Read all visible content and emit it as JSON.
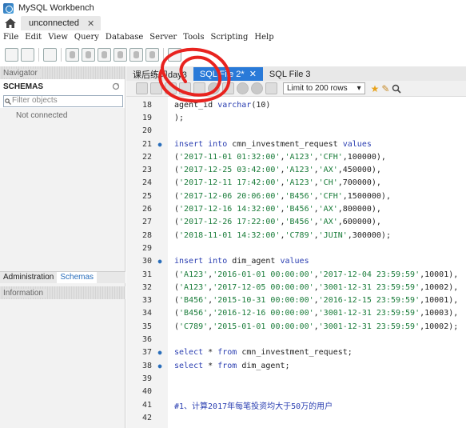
{
  "window": {
    "title": "MySQL Workbench"
  },
  "connection_tab": {
    "label": "unconnected"
  },
  "menu": [
    "File",
    "Edit",
    "View",
    "Query",
    "Database",
    "Server",
    "Tools",
    "Scripting",
    "Help"
  ],
  "navigator": {
    "header": "Navigator",
    "schemas_title": "SCHEMAS",
    "filter_placeholder": "Filter objects",
    "status": "Not connected",
    "tabs": [
      "Administration",
      "Schemas"
    ],
    "info_header": "Information"
  },
  "doc_tabs": [
    {
      "label": "课后练习day3",
      "active": false
    },
    {
      "label": "SQL File 2*",
      "active": true
    },
    {
      "label": "SQL File 3",
      "active": false
    }
  ],
  "editor_toolbar": {
    "limit": "Limit to 200 rows"
  },
  "code_lines": [
    {
      "n": "18",
      "m": "",
      "t": [
        [
          "",
          "agent_id "
        ],
        [
          "kw",
          "varchar"
        ],
        [
          "",
          "(10)"
        ]
      ]
    },
    {
      "n": "19",
      "m": "",
      "t": [
        [
          "",
          ");"
        ]
      ]
    },
    {
      "n": "20",
      "m": "",
      "t": []
    },
    {
      "n": "21",
      "m": "●",
      "t": [
        [
          "kw",
          "insert into "
        ],
        [
          "",
          "cmn_investment_request "
        ],
        [
          "kw",
          "values"
        ]
      ]
    },
    {
      "n": "22",
      "m": "",
      "t": [
        [
          "",
          "("
        ],
        [
          "str",
          "'2017-11-01 01:32:00'"
        ],
        [
          "",
          ","
        ],
        [
          "str",
          "'A123'"
        ],
        [
          "",
          ","
        ],
        [
          "str",
          "'CFH'"
        ],
        [
          "",
          ",100000),"
        ]
      ]
    },
    {
      "n": "23",
      "m": "",
      "t": [
        [
          "",
          "("
        ],
        [
          "str",
          "'2017-12-25 03:42:00'"
        ],
        [
          "",
          ","
        ],
        [
          "str",
          "'A123'"
        ],
        [
          "",
          ","
        ],
        [
          "str",
          "'AX'"
        ],
        [
          "",
          ",450000),"
        ]
      ]
    },
    {
      "n": "24",
      "m": "",
      "t": [
        [
          "",
          "("
        ],
        [
          "str",
          "'2017-12-11 17:42:00'"
        ],
        [
          "",
          ","
        ],
        [
          "str",
          "'A123'"
        ],
        [
          "",
          ","
        ],
        [
          "str",
          "'CH'"
        ],
        [
          "",
          ",700000),"
        ]
      ]
    },
    {
      "n": "25",
      "m": "",
      "t": [
        [
          "",
          "("
        ],
        [
          "str",
          "'2017-12-06 20:06:00'"
        ],
        [
          "",
          ","
        ],
        [
          "str",
          "'B456'"
        ],
        [
          "",
          ","
        ],
        [
          "str",
          "'CFH'"
        ],
        [
          "",
          ",1500000),"
        ]
      ]
    },
    {
      "n": "26",
      "m": "",
      "t": [
        [
          "",
          "("
        ],
        [
          "str",
          "'2017-12-16 14:32:00'"
        ],
        [
          "",
          ","
        ],
        [
          "str",
          "'B456'"
        ],
        [
          "",
          ","
        ],
        [
          "str",
          "'AX'"
        ],
        [
          "",
          ",800000),"
        ]
      ]
    },
    {
      "n": "27",
      "m": "",
      "t": [
        [
          "",
          "("
        ],
        [
          "str",
          "'2017-12-26 17:22:00'"
        ],
        [
          "",
          ","
        ],
        [
          "str",
          "'B456'"
        ],
        [
          "",
          ","
        ],
        [
          "str",
          "'AX'"
        ],
        [
          "",
          ",600000),"
        ]
      ]
    },
    {
      "n": "28",
      "m": "",
      "t": [
        [
          "",
          "("
        ],
        [
          "str",
          "'2018-11-01 14:32:00'"
        ],
        [
          "",
          ","
        ],
        [
          "str",
          "'C789'"
        ],
        [
          "",
          ","
        ],
        [
          "str",
          "'JUIN'"
        ],
        [
          "",
          ",300000);"
        ]
      ]
    },
    {
      "n": "29",
      "m": "",
      "t": []
    },
    {
      "n": "30",
      "m": "●",
      "t": [
        [
          "kw",
          "insert into "
        ],
        [
          "",
          "dim_agent "
        ],
        [
          "kw",
          "values"
        ]
      ]
    },
    {
      "n": "31",
      "m": "",
      "t": [
        [
          "",
          "("
        ],
        [
          "str",
          "'A123'"
        ],
        [
          "",
          ","
        ],
        [
          "str",
          "'2016-01-01 00:00:00'"
        ],
        [
          "",
          ","
        ],
        [
          "str",
          "'2017-12-04 23:59:59'"
        ],
        [
          "",
          ",10001),"
        ]
      ]
    },
    {
      "n": "32",
      "m": "",
      "t": [
        [
          "",
          "("
        ],
        [
          "str",
          "'A123'"
        ],
        [
          "",
          ","
        ],
        [
          "str",
          "'2017-12-05 00:00:00'"
        ],
        [
          "",
          ","
        ],
        [
          "str",
          "'3001-12-31 23:59:59'"
        ],
        [
          "",
          ",10002),"
        ]
      ]
    },
    {
      "n": "33",
      "m": "",
      "t": [
        [
          "",
          "("
        ],
        [
          "str",
          "'B456'"
        ],
        [
          "",
          ","
        ],
        [
          "str",
          "'2015-10-31 00:00:00'"
        ],
        [
          "",
          ","
        ],
        [
          "str",
          "'2016-12-15 23:59:59'"
        ],
        [
          "",
          ",10001),"
        ]
      ]
    },
    {
      "n": "34",
      "m": "",
      "t": [
        [
          "",
          "("
        ],
        [
          "str",
          "'B456'"
        ],
        [
          "",
          ","
        ],
        [
          "str",
          "'2016-12-16 00:00:00'"
        ],
        [
          "",
          ","
        ],
        [
          "str",
          "'3001-12-31 23:59:59'"
        ],
        [
          "",
          ",10003),"
        ]
      ]
    },
    {
      "n": "35",
      "m": "",
      "t": [
        [
          "",
          "("
        ],
        [
          "str",
          "'C789'"
        ],
        [
          "",
          ","
        ],
        [
          "str",
          "'2015-01-01 00:00:00'"
        ],
        [
          "",
          ","
        ],
        [
          "str",
          "'3001-12-31 23:59:59'"
        ],
        [
          "",
          ",10002);"
        ]
      ]
    },
    {
      "n": "36",
      "m": "",
      "t": []
    },
    {
      "n": "37",
      "m": "●",
      "t": [
        [
          "kw",
          "select "
        ],
        [
          "",
          "* "
        ],
        [
          "kw",
          "from "
        ],
        [
          "",
          "cmn_investment_request;"
        ]
      ]
    },
    {
      "n": "38",
      "m": "●",
      "t": [
        [
          "kw",
          "select "
        ],
        [
          "",
          "* "
        ],
        [
          "kw",
          "from "
        ],
        [
          "",
          "dim_agent;"
        ]
      ]
    },
    {
      "n": "39",
      "m": "",
      "t": []
    },
    {
      "n": "40",
      "m": "",
      "t": []
    },
    {
      "n": "41",
      "m": "",
      "t": [
        [
          "cm",
          "#1、计算2017年每笔投资均大于50万的用户"
        ]
      ]
    },
    {
      "n": "42",
      "m": "",
      "t": []
    }
  ],
  "colors": {
    "accent": "#2a7ad8",
    "annotation": "#e8231f"
  }
}
